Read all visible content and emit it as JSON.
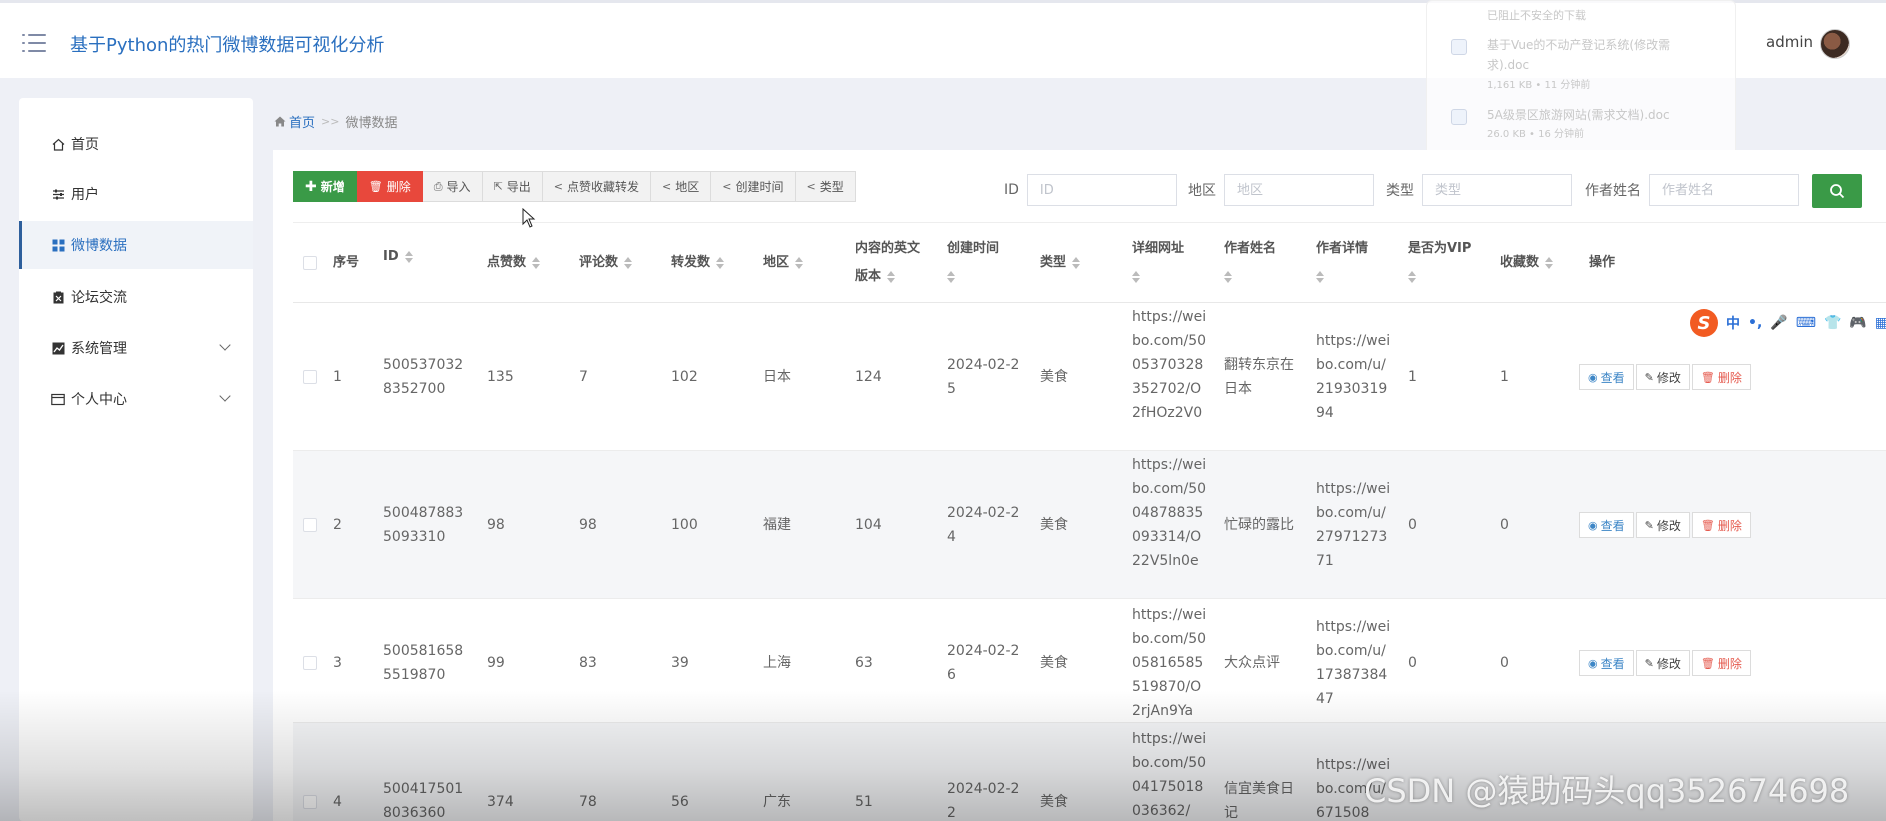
{
  "app": {
    "title": "基于Python的热门微博数据可视化分析",
    "user": "admin"
  },
  "download_popup": {
    "note": "已阻止不安全的下载",
    "items": [
      {
        "name": "基于Vue的不动产登记系统(修改需求).doc",
        "meta": "1,161 KB • 11 分钟前"
      },
      {
        "name": "5A级景区旅游网站(需求文档).doc",
        "meta": "26.0 KB • 16 分钟前"
      }
    ]
  },
  "sidebar": {
    "items": [
      {
        "label": "首页",
        "icon": "home-icon"
      },
      {
        "label": "用户",
        "icon": "sliders-icon"
      },
      {
        "label": "微博数据",
        "icon": "grid-icon",
        "active": true
      },
      {
        "label": "论坛交流",
        "icon": "clipboard-icon"
      },
      {
        "label": "系统管理",
        "icon": "chart-icon",
        "expandable": true
      },
      {
        "label": "个人中心",
        "icon": "wallet-icon",
        "expandable": true
      }
    ]
  },
  "breadcrumb": {
    "home": "首页",
    "separator": ">>",
    "current": "微博数据"
  },
  "toolbar": {
    "add": "新增",
    "delete": "删除",
    "import": "导入",
    "export": "导出",
    "stat_likes": "点赞收藏转发",
    "stat_region": "地区",
    "stat_time": "创建时间",
    "stat_type": "类型"
  },
  "filters": [
    {
      "label": "ID",
      "placeholder": "ID"
    },
    {
      "label": "地区",
      "placeholder": "地区"
    },
    {
      "label": "类型",
      "placeholder": "类型"
    },
    {
      "label": "作者姓名",
      "placeholder": "作者姓名"
    }
  ],
  "table": {
    "columns": [
      "序号",
      "ID",
      "点赞数",
      "评论数",
      "转发数",
      "地区",
      "内容的英文版本",
      "创建时间",
      "类型",
      "详细网址",
      "作者姓名",
      "作者详情",
      "是否为VIP",
      "收藏数",
      "操作"
    ],
    "actions": {
      "view": "查看",
      "edit": "修改",
      "delete": "删除"
    },
    "rows": [
      {
        "no": "1",
        "id": "5005370328352700",
        "likes": "135",
        "comments": "7",
        "reposts": "102",
        "region": "日本",
        "en": "124",
        "created": "2024-02-25",
        "type": "美食",
        "url": "https://weibo.com/5005370328352702/O2fHOz2V0",
        "author": "翻转东京在日本",
        "author_url": "https://weibo.com/u/2193031994",
        "vip": "1",
        "favs": "1"
      },
      {
        "no": "2",
        "id": "5004878835093310",
        "likes": "98",
        "comments": "98",
        "reposts": "100",
        "region": "福建",
        "en": "104",
        "created": "2024-02-24",
        "type": "美食",
        "url": "https://weibo.com/5004878835093314/O22V5ln0e",
        "author": "忙碌的露比",
        "author_url": "https://weibo.com/u/2797127371",
        "vip": "0",
        "favs": "0"
      },
      {
        "no": "3",
        "id": "5005816585519870",
        "likes": "99",
        "comments": "83",
        "reposts": "39",
        "region": "上海",
        "en": "63",
        "created": "2024-02-26",
        "type": "美食",
        "url": "https://weibo.com/5005816585519870/O2rjAn9Ya",
        "author": "大众点评",
        "author_url": "https://weibo.com/u/1738738447",
        "vip": "0",
        "favs": "0"
      },
      {
        "no": "4",
        "id": "5004175018036360",
        "likes": "374",
        "comments": "78",
        "reposts": "56",
        "region": "广东",
        "en": "51",
        "created": "2024-02-22",
        "type": "美食",
        "url": "https://weibo.com/5004175018036362/",
        "author": "信宜美食日记",
        "author_url": "https://weibo.com/u/671508",
        "vip": "",
        "favs": ""
      }
    ]
  },
  "ime": {
    "labels": [
      "中",
      "•,",
      "🎤",
      "⌨",
      "👕",
      "🎮",
      "▦"
    ]
  },
  "watermark": "CSDN @猿助码头qq352674698",
  "colors": {
    "accent": "#2a6fbf",
    "success": "#3a9a47",
    "danger": "#e8483c"
  }
}
